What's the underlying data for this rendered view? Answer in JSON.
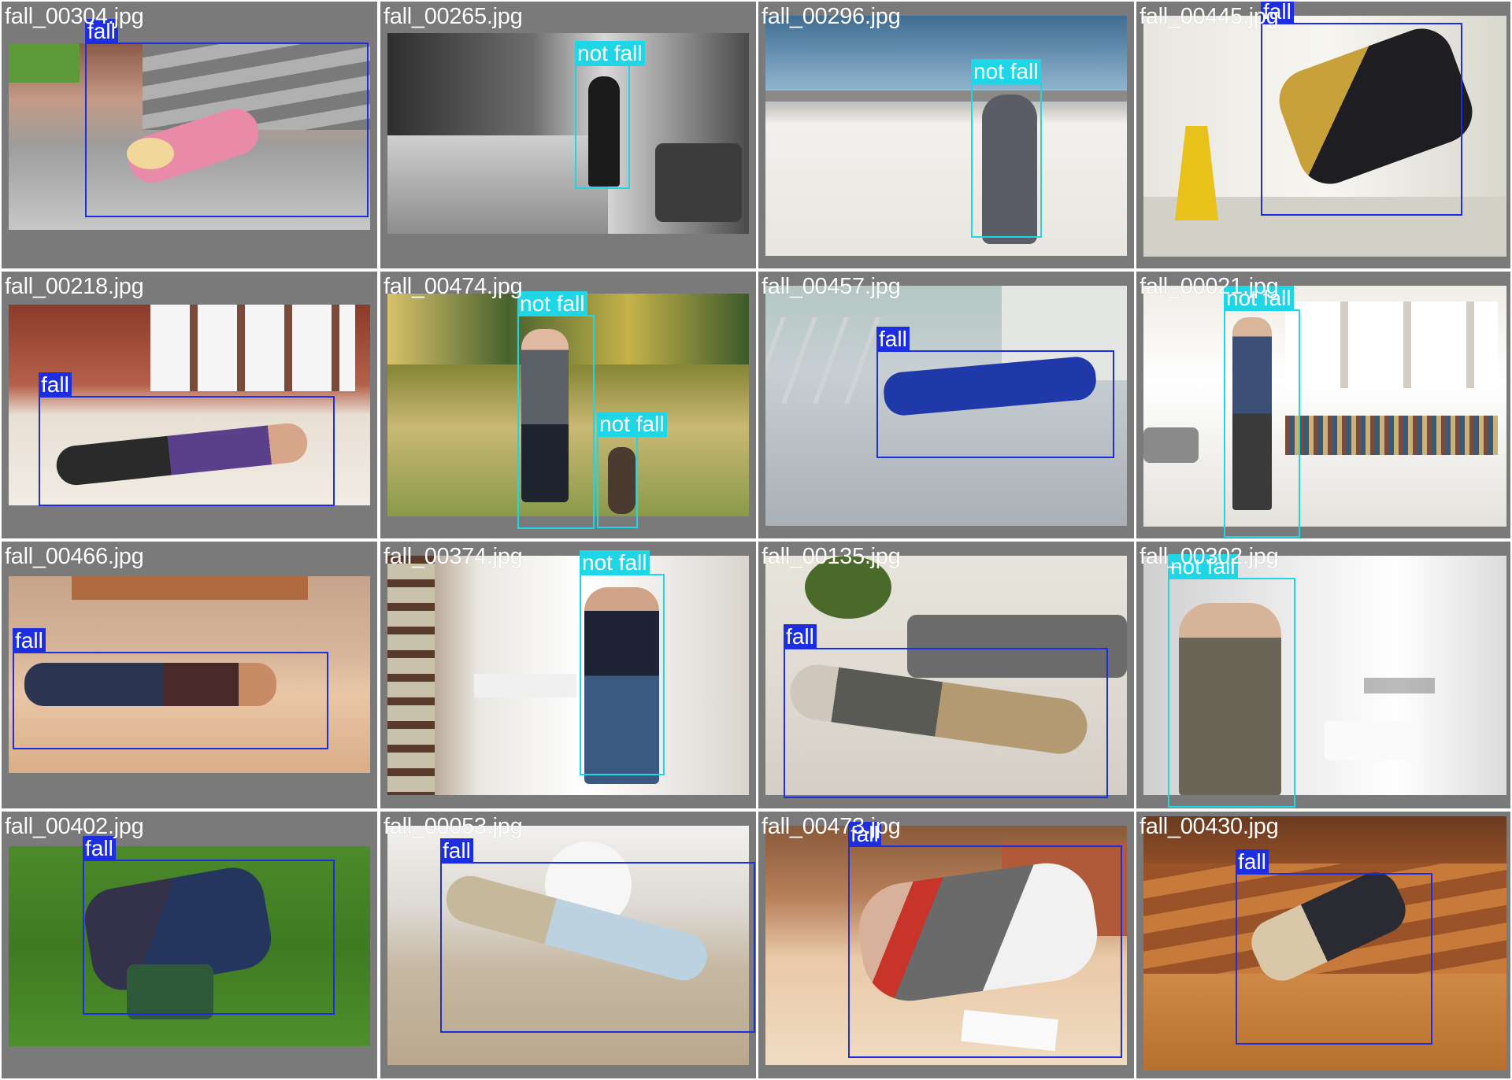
{
  "colors": {
    "fall": "#1c2ee0",
    "not_fall": "#1fd6e6",
    "cell_bg": "#7a7a7a",
    "divider": "#ffffff"
  },
  "tiles": [
    {
      "filename": "fall_00304.jpg",
      "scene": "stairs",
      "detections": [
        {
          "label": "fall"
        }
      ]
    },
    {
      "filename": "fall_00265.jpg",
      "scene": "bedroom_bw",
      "detections": [
        {
          "label": "not fall"
        }
      ]
    },
    {
      "filename": "fall_00296.jpg",
      "scene": "desert",
      "detections": [
        {
          "label": "not fall"
        }
      ]
    },
    {
      "filename": "fall_00445.jpg",
      "scene": "hallway_sign",
      "detections": [
        {
          "label": "fall"
        }
      ]
    },
    {
      "filename": "fall_00218.jpg",
      "scene": "tiled_room",
      "detections": [
        {
          "label": "fall"
        }
      ]
    },
    {
      "filename": "fall_00474.jpg",
      "scene": "meadow",
      "detections": [
        {
          "label": "not fall"
        },
        {
          "label": "not fall"
        }
      ]
    },
    {
      "filename": "fall_00457.jpg",
      "scene": "ladder_floor",
      "detections": [
        {
          "label": "fall"
        }
      ]
    },
    {
      "filename": "fall_00021.jpg",
      "scene": "library_room",
      "detections": [
        {
          "label": "not fall"
        }
      ]
    },
    {
      "filename": "fall_00466.jpg",
      "scene": "under_table",
      "detections": [
        {
          "label": "fall"
        }
      ]
    },
    {
      "filename": "fall_00374.jpg",
      "scene": "living_vacuum",
      "detections": [
        {
          "label": "not fall"
        }
      ]
    },
    {
      "filename": "fall_00135.jpg",
      "scene": "sofa_floor",
      "detections": [
        {
          "label": "fall"
        }
      ]
    },
    {
      "filename": "fall_00302.jpg",
      "scene": "bathroom",
      "detections": [
        {
          "label": "not fall"
        }
      ]
    },
    {
      "filename": "fall_00402.jpg",
      "scene": "grass_chair",
      "detections": [
        {
          "label": "fall"
        }
      ]
    },
    {
      "filename": "fall_00053.jpg",
      "scene": "floor_chair",
      "detections": [
        {
          "label": "fall"
        }
      ]
    },
    {
      "filename": "fall_00473.jpg",
      "scene": "kitchen_floor",
      "detections": [
        {
          "label": "fall"
        }
      ]
    },
    {
      "filename": "fall_00430.jpg",
      "scene": "wood_steps",
      "detections": [
        {
          "label": "fall"
        }
      ]
    }
  ]
}
